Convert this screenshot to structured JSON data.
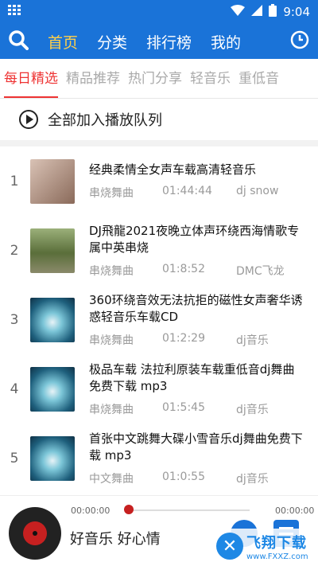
{
  "status_bar": {
    "time": "9:04"
  },
  "nav": {
    "tabs": [
      {
        "label": "首页"
      },
      {
        "label": "分类"
      },
      {
        "label": "排行榜"
      },
      {
        "label": "我的"
      }
    ],
    "active_index": 0
  },
  "subtabs": [
    {
      "label": "每日精选"
    },
    {
      "label": "精品推荐"
    },
    {
      "label": "热门分享"
    },
    {
      "label": "轻音乐"
    },
    {
      "label": "重低音"
    }
  ],
  "queue": {
    "label": "全部加入播放队列"
  },
  "songs": [
    {
      "index": "1",
      "title": "经典柔情全女声车载高清轻音乐",
      "category": "串烧舞曲",
      "duration": "01:44:44",
      "uploader": "dj snow",
      "thumb_color": "#8a6a5a"
    },
    {
      "index": "2",
      "title": "DJ飛龍2021夜晚立体声环绕西海情歌专属中英串烧",
      "category": "串烧舞曲",
      "duration": "01:8:52",
      "uploader": "DMC飞龙",
      "thumb_color": "#6f8a4a"
    },
    {
      "index": "3",
      "title": "360环绕音效无法抗拒的磁性女声奢华诱惑轻音乐车载CD",
      "category": "串烧舞曲",
      "duration": "01:2:29",
      "uploader": "dj音乐",
      "thumb_color": "#2a7fa0"
    },
    {
      "index": "4",
      "title": "极品车载 法拉利原装车载重低音dj舞曲免费下载 mp3",
      "category": "串烧舞曲",
      "duration": "01:5:45",
      "uploader": "dj音乐",
      "thumb_color": "#2a7fa0"
    },
    {
      "index": "5",
      "title": "首张中文跳舞大碟小雪音乐dj舞曲免费下载 mp3",
      "category": "中文舞曲",
      "duration": "01:0:55",
      "uploader": "dj音乐",
      "thumb_color": "#2a7fa0"
    }
  ],
  "player": {
    "current_time": "00:00:00",
    "total_time": "00:00:00",
    "progress_fraction": 0.0,
    "slogan": "好音乐 好心情"
  },
  "watermark": {
    "name": "飞翔下载",
    "url": "www.FXXZ.com"
  },
  "colors": {
    "primary": "#1a73d8",
    "active_nav": "#ffd04a",
    "active_subtab": "#e33333"
  }
}
